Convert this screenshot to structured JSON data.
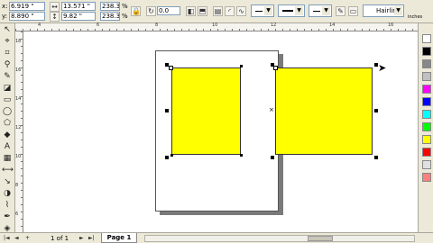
{
  "property_bar": {
    "x_label": "x:",
    "x_value": "6.919 \"",
    "y_label": "y:",
    "y_value": "8.890 \"",
    "width_value": "13.571 \"",
    "height_value": "9.82 \"",
    "scale_x": "238.3",
    "scale_y": "238.3",
    "percent_x": "%",
    "percent_y": "%",
    "rotation_value": "0.0",
    "outline_width": "Hairline",
    "units_label": "inches"
  },
  "ruler": {
    "h_labels": [
      "4",
      "6",
      "8",
      "10",
      "12",
      "14",
      "16"
    ],
    "v_labels": [
      "18",
      "16",
      "14",
      "12",
      "10",
      "8",
      "6"
    ]
  },
  "statusbar": {
    "page_count": "1 of 1",
    "page_tab": "Page 1",
    "first_btn": "|◄",
    "prev_btn": "◄",
    "next_btn": "►",
    "last_btn": "►|"
  },
  "palette": {
    "colors": [
      "#ffffff",
      "#000000",
      "#888888",
      "#c0c0c0",
      "#ff00ff",
      "#0000ff",
      "#00ffff",
      "#00ff00",
      "#ffff00",
      "#ff0000",
      "#e0e0e0",
      "#ff8080"
    ]
  },
  "canvas": {
    "shape_fill": "#ffff00"
  }
}
